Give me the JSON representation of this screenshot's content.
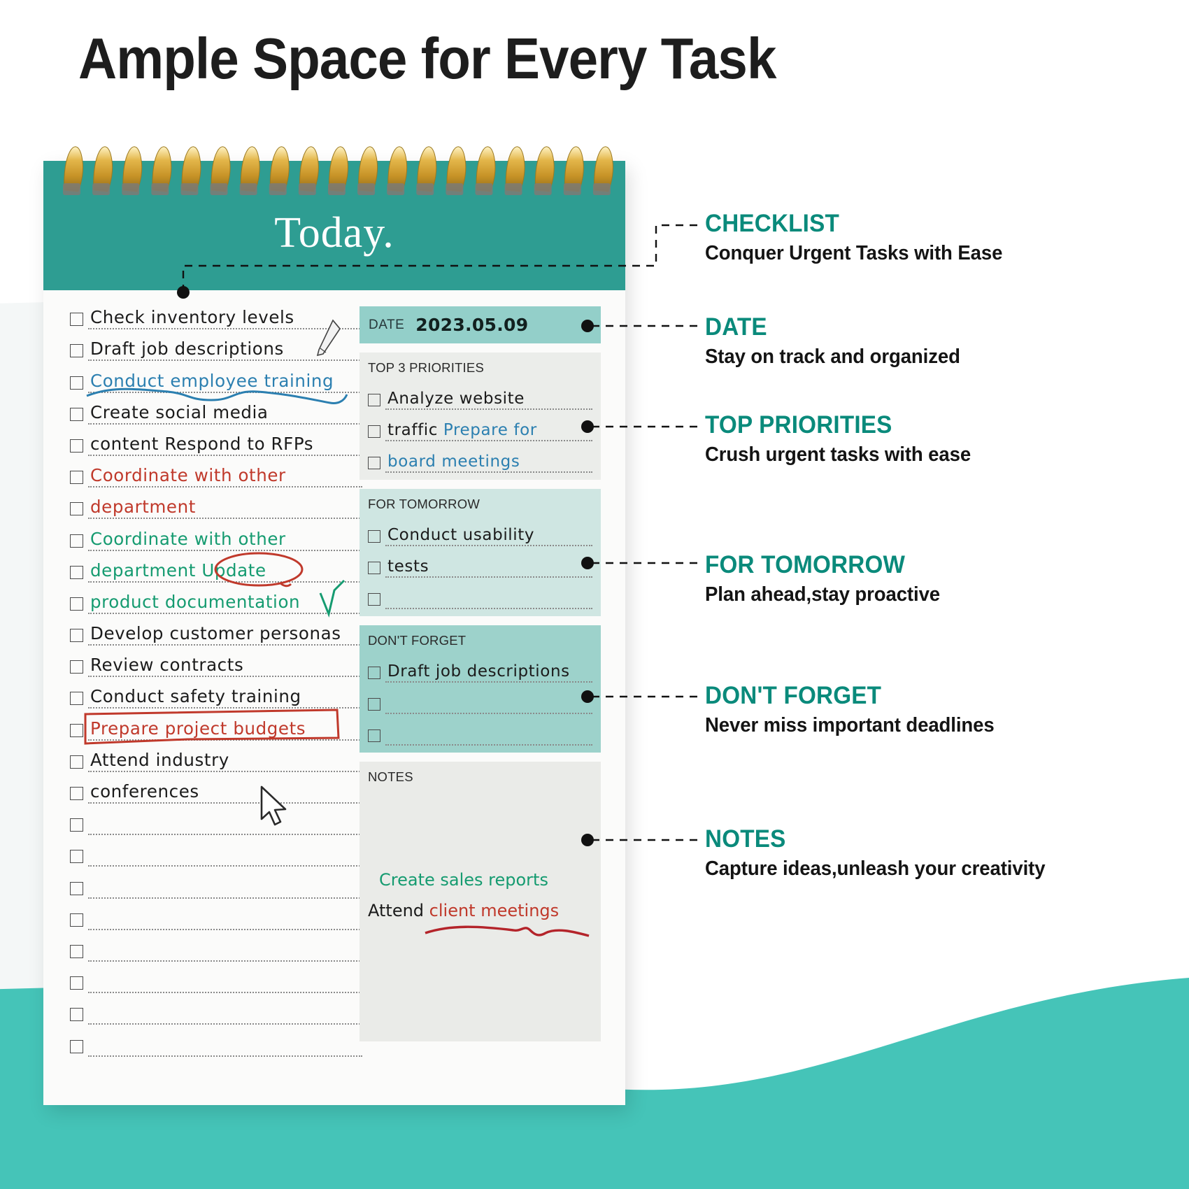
{
  "page": {
    "title": "Ample Space for Every Task",
    "accent_teal": "#0a8a7b",
    "header_teal": "#2e9d92",
    "wave_teal": "#45c4b8"
  },
  "notepad": {
    "header_title": "Today.",
    "checklist": [
      {
        "text": "Check inventory levels",
        "color": "black",
        "mark": "none"
      },
      {
        "text": "Draft job descriptions",
        "color": "black",
        "mark": "pen-icon"
      },
      {
        "text": "Conduct employee training",
        "color": "blue",
        "mark": "wavy-underline"
      },
      {
        "text": "Create social media",
        "color": "black",
        "mark": "none"
      },
      {
        "text": "content Respond to RFPs",
        "color": "black",
        "mark": "none"
      },
      {
        "text": "Coordinate with other",
        "color": "red",
        "mark": "none"
      },
      {
        "text": "department",
        "color": "red",
        "mark": "none"
      },
      {
        "text": "Coordinate with other",
        "color": "green",
        "mark": "none"
      },
      {
        "text": "department Update",
        "color": "green",
        "mark": "red-circle"
      },
      {
        "text": "product documentation",
        "color": "green",
        "mark": "green-check"
      },
      {
        "text": "Develop customer personas",
        "color": "black",
        "mark": "none"
      },
      {
        "text": "Review contracts",
        "color": "black",
        "mark": "none"
      },
      {
        "text": "Conduct safety training",
        "color": "black",
        "mark": "none"
      },
      {
        "text": "Prepare project budgets",
        "color": "red",
        "mark": "red-box"
      },
      {
        "text": "Attend industry",
        "color": "black",
        "mark": "none"
      },
      {
        "text": "conferences",
        "color": "black",
        "mark": "cursor"
      },
      {
        "text": "",
        "color": "black",
        "mark": "none"
      },
      {
        "text": "",
        "color": "black",
        "mark": "none"
      },
      {
        "text": "",
        "color": "black",
        "mark": "none"
      },
      {
        "text": "",
        "color": "black",
        "mark": "none"
      },
      {
        "text": "",
        "color": "black",
        "mark": "none"
      },
      {
        "text": "",
        "color": "black",
        "mark": "none"
      },
      {
        "text": "",
        "color": "black",
        "mark": "none"
      },
      {
        "text": "",
        "color": "black",
        "mark": "none"
      }
    ],
    "date_panel": {
      "label": "DATE",
      "value": "2023.05.09"
    },
    "top_priorities": {
      "label": "TOP 3 PRIORITIES",
      "items": [
        {
          "text": "Analyze website",
          "color": "black"
        },
        {
          "text": "traffic Prepare for",
          "color": "mixed-blue"
        },
        {
          "text": "board meetings",
          "color": "blue"
        }
      ]
    },
    "for_tomorrow": {
      "label": "FOR TOMORROW",
      "items": [
        {
          "text": "Conduct usability",
          "color": "black"
        },
        {
          "text": "tests",
          "color": "black"
        },
        {
          "text": "",
          "color": "black"
        }
      ]
    },
    "dont_forget": {
      "label": "DON'T FORGET",
      "items": [
        {
          "text": "Draft job descriptions",
          "color": "black"
        },
        {
          "text": "",
          "color": "black"
        },
        {
          "text": "",
          "color": "black"
        }
      ]
    },
    "notes": {
      "label": "NOTES",
      "lines": [
        {
          "text": "Create sales reports",
          "color": "green",
          "mark": "none"
        },
        {
          "text_black": "Attend ",
          "text_red": "client meetings",
          "color": "mixed-red",
          "mark": "red-squiggle-underline"
        }
      ]
    }
  },
  "annotations": [
    {
      "title": "CHECKLIST",
      "subtitle": "Conquer Urgent Tasks with Ease"
    },
    {
      "title": "DATE",
      "subtitle": "Stay on track and organized"
    },
    {
      "title": "TOP PRIORITIES",
      "subtitle": "Crush urgent tasks with ease"
    },
    {
      "title": "FOR TOMORROW",
      "subtitle": "Plan ahead,stay proactive"
    },
    {
      "title": "DON'T FORGET",
      "subtitle": "Never miss important deadlines"
    },
    {
      "title": "NOTES",
      "subtitle": "Capture ideas,unleash your creativity"
    }
  ]
}
